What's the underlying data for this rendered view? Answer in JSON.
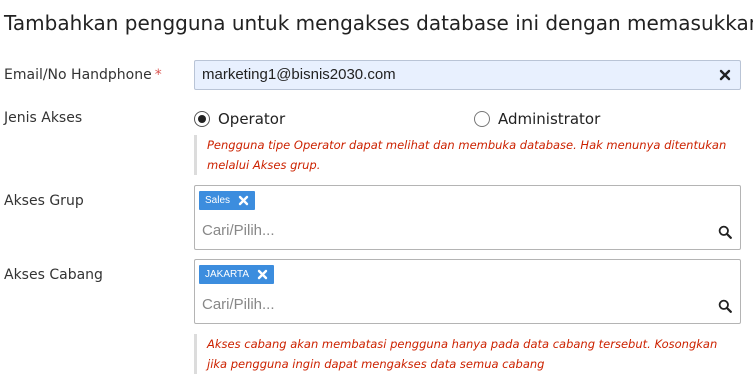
{
  "header": {
    "title": "Tambahkan pengguna untuk mengakses database ini dengan memasukkan n"
  },
  "email": {
    "label": "Email/No Handphone",
    "required_mark": "*",
    "value": "marketing1@bisnis2030.com",
    "clear_icon": "close-icon"
  },
  "access_type": {
    "label": "Jenis Akses",
    "options": [
      {
        "label": "Operator",
        "selected": true
      },
      {
        "label": "Administrator",
        "selected": false
      }
    ],
    "note": "Pengguna tipe Operator dapat melihat dan membuka database. Hak menunya ditentukan melalui Akses grup."
  },
  "group_access": {
    "label": "Akses Grup",
    "tags": [
      "Sales"
    ],
    "placeholder": "Cari/Pilih...",
    "search_icon": "search-icon"
  },
  "branch_access": {
    "label": "Akses Cabang",
    "tags": [
      "JAKARTA"
    ],
    "placeholder": "Cari/Pilih...",
    "search_icon": "search-icon",
    "note": "Akses cabang akan membatasi pengguna hanya pada data cabang tersebut. Kosongkan jika pengguna ingin dapat mengakses data semua cabang"
  },
  "colors": {
    "tag_bg": "#3c8dde",
    "note_text": "#cc2200",
    "input_autofill_bg": "#e8f0fe"
  }
}
